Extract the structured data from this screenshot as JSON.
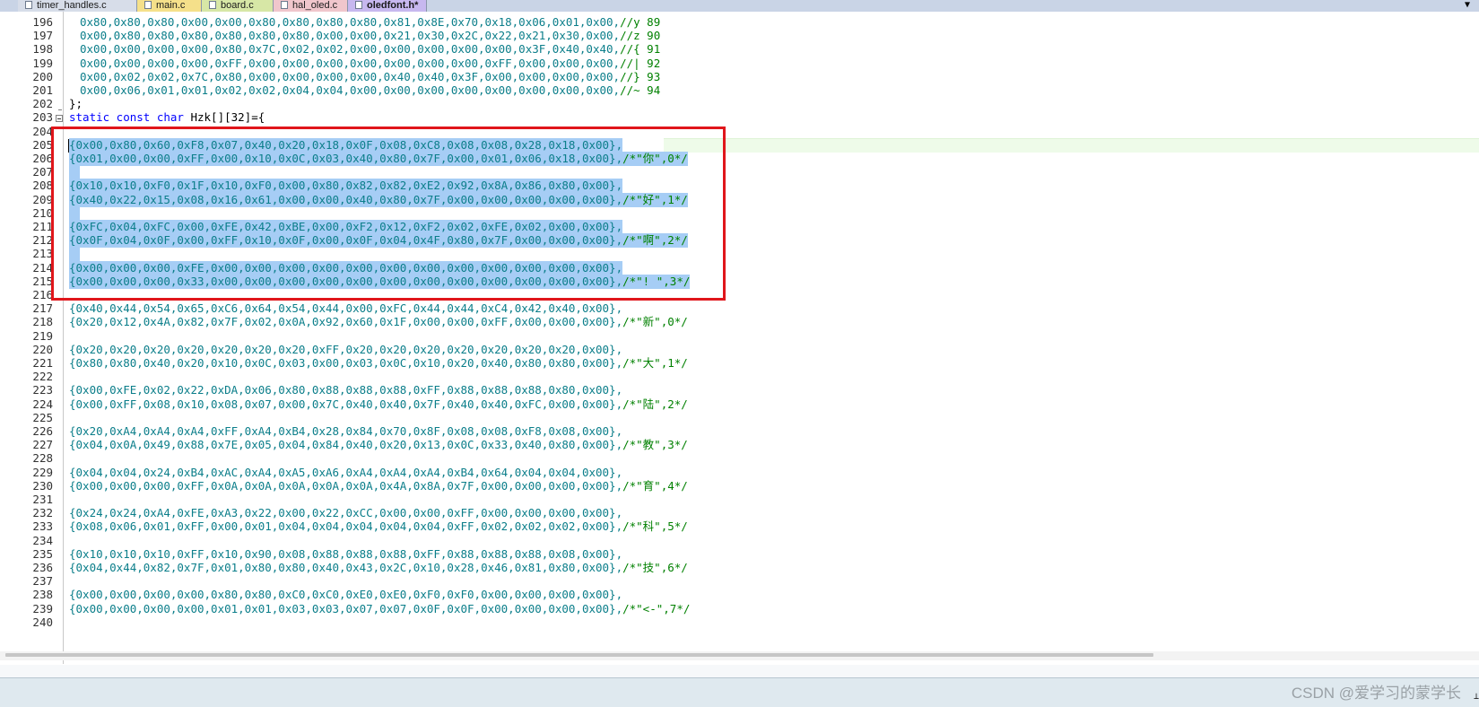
{
  "tabs": [
    {
      "label": "timer_handles.c",
      "color": "#d7dde9",
      "active": false
    },
    {
      "label": "main.c",
      "color": "#f5e08a",
      "active": false
    },
    {
      "label": "board.c",
      "color": "#d7e7a6",
      "active": false
    },
    {
      "label": "hal_oled.c",
      "color": "#f0c6cc",
      "active": false
    },
    {
      "label": "oledfont.h*",
      "color": "#c7b8ef",
      "active": true
    }
  ],
  "lines": [
    {
      "n": "196",
      "code": "0x80,0x80,0x80,0x00,0x00,0x80,0x80,0x80,0x80,0x81,0x8E,0x70,0x18,0x06,0x01,0x00,",
      "comment": "//y 89"
    },
    {
      "n": "197",
      "code": "0x00,0x80,0x80,0x80,0x80,0x80,0x80,0x00,0x00,0x21,0x30,0x2C,0x22,0x21,0x30,0x00,",
      "comment": "//z 90"
    },
    {
      "n": "198",
      "code": "0x00,0x00,0x00,0x00,0x80,0x7C,0x02,0x02,0x00,0x00,0x00,0x00,0x00,0x3F,0x40,0x40,",
      "comment": "//{ 91"
    },
    {
      "n": "199",
      "code": "0x00,0x00,0x00,0x00,0xFF,0x00,0x00,0x00,0x00,0x00,0x00,0x00,0xFF,0x00,0x00,0x00,",
      "comment": "//| 92"
    },
    {
      "n": "200",
      "code": "0x00,0x02,0x02,0x7C,0x80,0x00,0x00,0x00,0x00,0x40,0x40,0x3F,0x00,0x00,0x00,0x00,",
      "comment": "//} 93"
    },
    {
      "n": "201",
      "code": "0x00,0x06,0x01,0x01,0x02,0x02,0x04,0x04,0x00,0x00,0x00,0x00,0x00,0x00,0x00,0x00,",
      "comment": "//~ 94"
    },
    {
      "n": "202",
      "code": "};",
      "comment": ""
    },
    {
      "n": "203",
      "code": "static const char Hzk[][32]={",
      "comment": ""
    },
    {
      "n": "204",
      "code": "",
      "comment": ""
    },
    {
      "n": "205",
      "code": "{0x00,0x80,0x60,0xF8,0x07,0x40,0x20,0x18,0x0F,0x08,0xC8,0x08,0x08,0x28,0x18,0x00},",
      "comment": ""
    },
    {
      "n": "206",
      "code": "{0x01,0x00,0x00,0xFF,0x00,0x10,0x0C,0x03,0x40,0x80,0x7F,0x00,0x01,0x06,0x18,0x00},",
      "comment": "/*\"你\",0*/"
    },
    {
      "n": "207",
      "code": "",
      "comment": ""
    },
    {
      "n": "208",
      "code": "{0x10,0x10,0xF0,0x1F,0x10,0xF0,0x00,0x80,0x82,0x82,0xE2,0x92,0x8A,0x86,0x80,0x00},",
      "comment": ""
    },
    {
      "n": "209",
      "code": "{0x40,0x22,0x15,0x08,0x16,0x61,0x00,0x00,0x40,0x80,0x7F,0x00,0x00,0x00,0x00,0x00},",
      "comment": "/*\"好\",1*/"
    },
    {
      "n": "210",
      "code": "",
      "comment": ""
    },
    {
      "n": "211",
      "code": "{0xFC,0x04,0xFC,0x00,0xFE,0x42,0xBE,0x00,0xF2,0x12,0xF2,0x02,0xFE,0x02,0x00,0x00},",
      "comment": ""
    },
    {
      "n": "212",
      "code": "{0x0F,0x04,0x0F,0x00,0xFF,0x10,0x0F,0x00,0x0F,0x04,0x4F,0x80,0x7F,0x00,0x00,0x00},",
      "comment": "/*\"啊\",2*/"
    },
    {
      "n": "213",
      "code": "",
      "comment": ""
    },
    {
      "n": "214",
      "code": "{0x00,0x00,0x00,0xFE,0x00,0x00,0x00,0x00,0x00,0x00,0x00,0x00,0x00,0x00,0x00,0x00},",
      "comment": ""
    },
    {
      "n": "215",
      "code": "{0x00,0x00,0x00,0x33,0x00,0x00,0x00,0x00,0x00,0x00,0x00,0x00,0x00,0x00,0x00,0x00},",
      "comment": "/*\"! \",3*/"
    },
    {
      "n": "216",
      "code": "",
      "comment": ""
    },
    {
      "n": "217",
      "code": "{0x40,0x44,0x54,0x65,0xC6,0x64,0x54,0x44,0x00,0xFC,0x44,0x44,0xC4,0x42,0x40,0x00},",
      "comment": ""
    },
    {
      "n": "218",
      "code": "{0x20,0x12,0x4A,0x82,0x7F,0x02,0x0A,0x92,0x60,0x1F,0x00,0x00,0xFF,0x00,0x00,0x00},",
      "comment": "/*\"新\",0*/"
    },
    {
      "n": "219",
      "code": "",
      "comment": ""
    },
    {
      "n": "220",
      "code": "{0x20,0x20,0x20,0x20,0x20,0x20,0x20,0xFF,0x20,0x20,0x20,0x20,0x20,0x20,0x20,0x00},",
      "comment": ""
    },
    {
      "n": "221",
      "code": "{0x80,0x80,0x40,0x20,0x10,0x0C,0x03,0x00,0x03,0x0C,0x10,0x20,0x40,0x80,0x80,0x00},",
      "comment": "/*\"大\",1*/"
    },
    {
      "n": "222",
      "code": "",
      "comment": ""
    },
    {
      "n": "223",
      "code": "{0x00,0xFE,0x02,0x22,0xDA,0x06,0x80,0x88,0x88,0x88,0xFF,0x88,0x88,0x88,0x80,0x00},",
      "comment": ""
    },
    {
      "n": "224",
      "code": "{0x00,0xFF,0x08,0x10,0x08,0x07,0x00,0x7C,0x40,0x40,0x7F,0x40,0x40,0xFC,0x00,0x00},",
      "comment": "/*\"陆\",2*/"
    },
    {
      "n": "225",
      "code": "",
      "comment": ""
    },
    {
      "n": "226",
      "code": "{0x20,0xA4,0xA4,0xA4,0xFF,0xA4,0xB4,0x28,0x84,0x70,0x8F,0x08,0x08,0xF8,0x08,0x00},",
      "comment": ""
    },
    {
      "n": "227",
      "code": "{0x04,0x0A,0x49,0x88,0x7E,0x05,0x04,0x84,0x40,0x20,0x13,0x0C,0x33,0x40,0x80,0x00},",
      "comment": "/*\"教\",3*/"
    },
    {
      "n": "228",
      "code": "",
      "comment": ""
    },
    {
      "n": "229",
      "code": "{0x04,0x04,0x24,0xB4,0xAC,0xA4,0xA5,0xA6,0xA4,0xA4,0xA4,0xB4,0x64,0x04,0x04,0x00},",
      "comment": ""
    },
    {
      "n": "230",
      "code": "{0x00,0x00,0x00,0xFF,0x0A,0x0A,0x0A,0x0A,0x0A,0x4A,0x8A,0x7F,0x00,0x00,0x00,0x00},",
      "comment": "/*\"育\",4*/"
    },
    {
      "n": "231",
      "code": "",
      "comment": ""
    },
    {
      "n": "232",
      "code": "{0x24,0x24,0xA4,0xFE,0xA3,0x22,0x00,0x22,0xCC,0x00,0x00,0xFF,0x00,0x00,0x00,0x00},",
      "comment": ""
    },
    {
      "n": "233",
      "code": "{0x08,0x06,0x01,0xFF,0x00,0x01,0x04,0x04,0x04,0x04,0x04,0xFF,0x02,0x02,0x02,0x00},",
      "comment": "/*\"科\",5*/"
    },
    {
      "n": "234",
      "code": "",
      "comment": ""
    },
    {
      "n": "235",
      "code": "{0x10,0x10,0x10,0xFF,0x10,0x90,0x08,0x88,0x88,0x88,0xFF,0x88,0x88,0x88,0x08,0x00},",
      "comment": ""
    },
    {
      "n": "236",
      "code": "{0x04,0x44,0x82,0x7F,0x01,0x80,0x80,0x40,0x43,0x2C,0x10,0x28,0x46,0x81,0x80,0x00},",
      "comment": "/*\"技\",6*/"
    },
    {
      "n": "237",
      "code": "",
      "comment": ""
    },
    {
      "n": "238",
      "code": "{0x00,0x00,0x00,0x00,0x80,0x80,0xC0,0xC0,0xE0,0xE0,0xF0,0xF0,0x00,0x00,0x00,0x00},",
      "comment": ""
    },
    {
      "n": "239",
      "code": "{0x00,0x00,0x00,0x00,0x01,0x01,0x03,0x03,0x07,0x07,0x0F,0x0F,0x00,0x00,0x00,0x00},",
      "comment": "/*\"<-\",7*/"
    },
    {
      "n": "240",
      "code": "",
      "comment": ""
    }
  ],
  "selection": {
    "first_line": "205",
    "last_line": "215"
  },
  "watermark": "CSDN @爱学习的蒙学长",
  "tab_dropdown_icon": "▼",
  "colors": {
    "selection": "#a6cdf5",
    "highlight_box": "#e0161b",
    "number": "#0b7e8a",
    "comment": "#008000",
    "keyword": "#0000ff"
  }
}
